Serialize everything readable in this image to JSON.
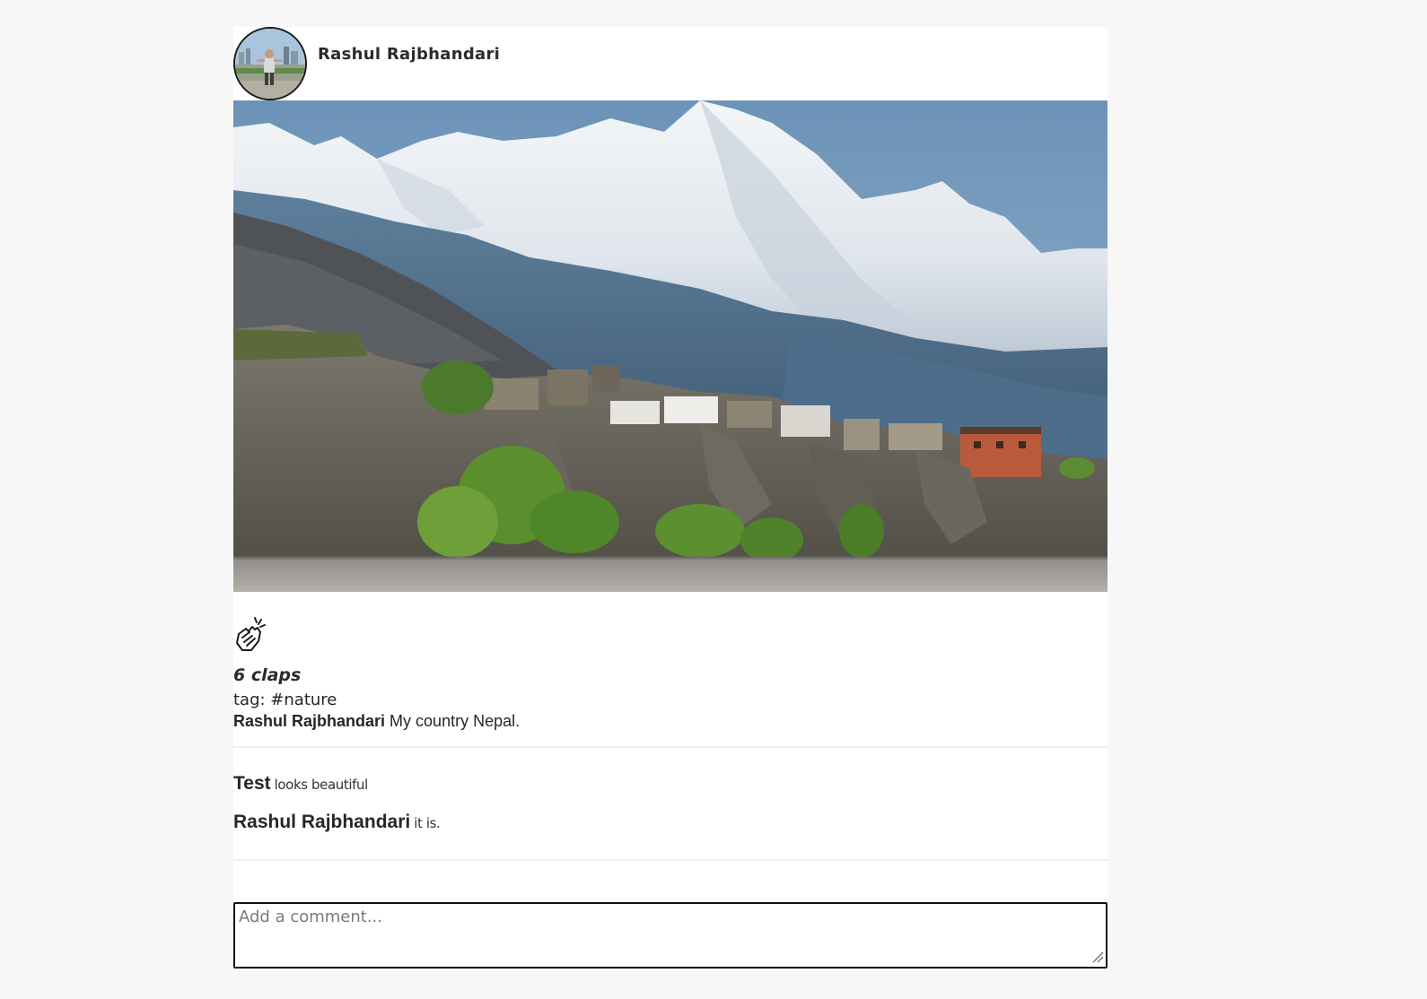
{
  "post": {
    "author": {
      "name": "Rashul Rajbhandari"
    },
    "image": {
      "subject": "mountain-village-photo"
    },
    "reactions": {
      "icon": "clap-icon",
      "claps_label": "6 claps"
    },
    "tag_line": "tag: #nature",
    "caption": {
      "author": "Rashul Rajbhandari",
      "text": "My country Nepal."
    },
    "comments": [
      {
        "author": "Test",
        "text": "looks beautiful"
      },
      {
        "author": "Rashul Rajbhandari",
        "text": "it is."
      }
    ],
    "comment_input": {
      "placeholder": "Add a comment...",
      "value": ""
    }
  },
  "colors": {
    "page_background": "#f7f7f7",
    "card_background": "#ffffff",
    "text": "#262626",
    "divider": "#efefef",
    "input_border": "#111111"
  }
}
